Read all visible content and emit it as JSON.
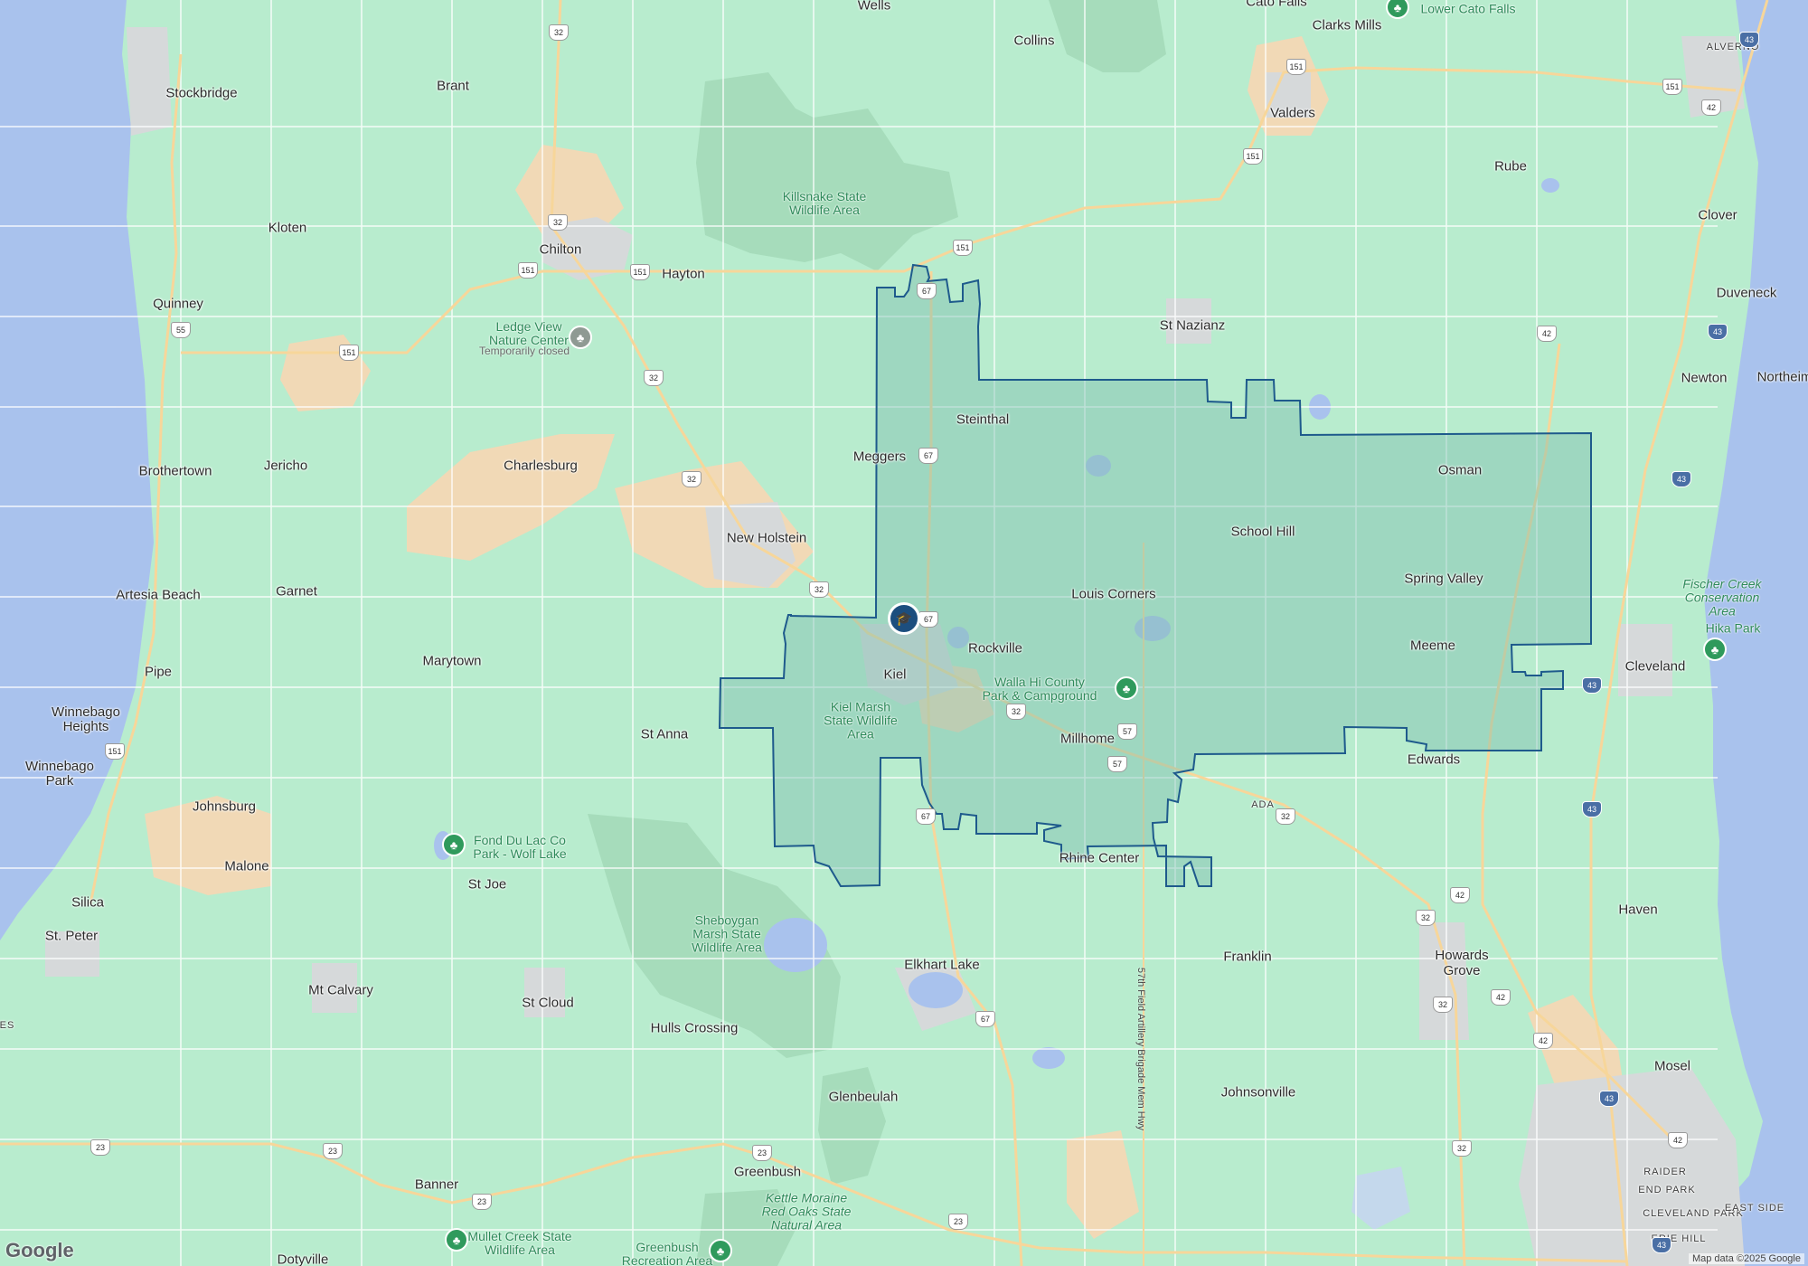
{
  "map": {
    "colors": {
      "land": "#b8ecce",
      "water": "#a9c2ed",
      "forest": "#a6dcbb",
      "urban": "#d6d9da",
      "farm": "#f1d9b6",
      "boundary_fill": "#7fbfb0",
      "boundary_stroke": "#1e5a8c",
      "road": "#ffffff",
      "highway": "#f7d69a"
    },
    "places": [
      {
        "id": "wells",
        "label": "Wells"
      },
      {
        "id": "cato-falls",
        "label": "Cato Falls"
      },
      {
        "id": "clarks-mills",
        "label": "Clarks Mills"
      },
      {
        "id": "collins",
        "label": "Collins"
      },
      {
        "id": "stockbridge",
        "label": "Stockbridge"
      },
      {
        "id": "brant",
        "label": "Brant"
      },
      {
        "id": "valders",
        "label": "Valders"
      },
      {
        "id": "rube",
        "label": "Rube"
      },
      {
        "id": "clover",
        "label": "Clover"
      },
      {
        "id": "kloten",
        "label": "Kloten"
      },
      {
        "id": "chilton",
        "label": "Chilton"
      },
      {
        "id": "hayton",
        "label": "Hayton"
      },
      {
        "id": "quinney",
        "label": "Quinney"
      },
      {
        "id": "st-nazianz",
        "label": "St Nazianz"
      },
      {
        "id": "duveneck",
        "label": "Duveneck"
      },
      {
        "id": "newton",
        "label": "Newton"
      },
      {
        "id": "northeim",
        "label": "Northeim"
      },
      {
        "id": "steinthal",
        "label": "Steinthal"
      },
      {
        "id": "meggers",
        "label": "Meggers"
      },
      {
        "id": "brothertown",
        "label": "Brothertown"
      },
      {
        "id": "jericho",
        "label": "Jericho"
      },
      {
        "id": "charlesburg",
        "label": "Charlesburg"
      },
      {
        "id": "osman",
        "label": "Osman"
      },
      {
        "id": "school-hill",
        "label": "School Hill"
      },
      {
        "id": "new-holstein",
        "label": "New Holstein"
      },
      {
        "id": "spring-valley",
        "label": "Spring Valley"
      },
      {
        "id": "artesia-beach",
        "label": "Artesia Beach"
      },
      {
        "id": "garnet",
        "label": "Garnet"
      },
      {
        "id": "louis-corners",
        "label": "Louis Corners"
      },
      {
        "id": "rockville",
        "label": "Rockville"
      },
      {
        "id": "meeme",
        "label": "Meeme"
      },
      {
        "id": "cleveland",
        "label": "Cleveland"
      },
      {
        "id": "marytown",
        "label": "Marytown"
      },
      {
        "id": "pipe",
        "label": "Pipe"
      },
      {
        "id": "kiel",
        "label": "Kiel"
      },
      {
        "id": "winnebago-heights",
        "label": "Winnebago\nHeights"
      },
      {
        "id": "st-anna",
        "label": "St Anna"
      },
      {
        "id": "millhome",
        "label": "Millhome"
      },
      {
        "id": "edwards",
        "label": "Edwards"
      },
      {
        "id": "winnebago-park",
        "label": "Winnebago\nPark"
      },
      {
        "id": "johnsburg",
        "label": "Johnsburg"
      },
      {
        "id": "malone",
        "label": "Malone"
      },
      {
        "id": "rhine-center",
        "label": "Rhine Center"
      },
      {
        "id": "st-joe",
        "label": "St Joe"
      },
      {
        "id": "silica",
        "label": "Silica"
      },
      {
        "id": "haven",
        "label": "Haven"
      },
      {
        "id": "st-peter",
        "label": "St. Peter"
      },
      {
        "id": "franklin",
        "label": "Franklin"
      },
      {
        "id": "howards-grove",
        "label": "Howards\nGrove"
      },
      {
        "id": "elkhart-lake",
        "label": "Elkhart Lake"
      },
      {
        "id": "mt-calvary",
        "label": "Mt Calvary"
      },
      {
        "id": "st-cloud",
        "label": "St Cloud"
      },
      {
        "id": "hulls-crossing",
        "label": "Hulls Crossing"
      },
      {
        "id": "mosel",
        "label": "Mosel"
      },
      {
        "id": "johnsonville",
        "label": "Johnsonville"
      },
      {
        "id": "glenbeulah",
        "label": "Glenbeulah"
      },
      {
        "id": "greenbush",
        "label": "Greenbush"
      },
      {
        "id": "banner",
        "label": "Banner"
      },
      {
        "id": "dotyville",
        "label": "Dotyville"
      }
    ],
    "small_labels": [
      {
        "id": "alverno",
        "label": "ALVERNO"
      },
      {
        "id": "ada",
        "label": "ADA"
      },
      {
        "id": "raider",
        "label": "RAIDER"
      },
      {
        "id": "end-park",
        "label": "END PARK"
      },
      {
        "id": "cleveland-park",
        "label": "CLEVELAND PARK"
      },
      {
        "id": "east-side",
        "label": "EAST SIDE"
      },
      {
        "id": "erie-hill",
        "label": "ERIE HILL"
      },
      {
        "id": "es",
        "label": "ES"
      }
    ],
    "parks": [
      {
        "id": "lower-cato-falls",
        "label": "Lower Cato Falls",
        "icon": "tree-icon"
      },
      {
        "id": "killsnake",
        "label": "Killsnake State\nWildlife Area",
        "icon": ""
      },
      {
        "id": "ledge-view",
        "label": "Ledge View\nNature Center",
        "icon": "tree-icon",
        "note": "Temporarily closed"
      },
      {
        "id": "fischer-creek",
        "label": "Fischer Creek\nConservation\nArea",
        "icon": ""
      },
      {
        "id": "hika-park",
        "label": "Hika Park",
        "icon": "tree-icon"
      },
      {
        "id": "walla-hi",
        "label": "Walla Hi County\nPark & Campground",
        "icon": "tree-icon"
      },
      {
        "id": "kiel-marsh",
        "label": "Kiel Marsh\nState Wildlife\nArea",
        "icon": ""
      },
      {
        "id": "fond-du-lac",
        "label": "Fond Du Lac Co\nPark - Wolf Lake",
        "icon": "tree-icon"
      },
      {
        "id": "sheboygan-marsh",
        "label": "Sheboygan\nMarsh State\nWildlife Area",
        "icon": ""
      },
      {
        "id": "kettle-moraine",
        "label": "Kettle Moraine\nRed Oaks State\nNatural Area",
        "icon": ""
      },
      {
        "id": "mullet-creek",
        "label": "Mullet Creek State\nWildlife Area",
        "icon": "tree-icon"
      },
      {
        "id": "greenbush-rec",
        "label": "Greenbush\nRecreation Area",
        "icon": "tree-icon"
      }
    ],
    "route_shields": [
      {
        "id": "r32a",
        "label": "32",
        "kind": "state"
      },
      {
        "id": "r151a",
        "label": "151",
        "kind": "us"
      },
      {
        "id": "r43a",
        "label": "43",
        "kind": "interstate"
      },
      {
        "id": "r42a",
        "label": "42",
        "kind": "state"
      },
      {
        "id": "r151b",
        "label": "151",
        "kind": "us"
      },
      {
        "id": "r151c",
        "label": "151",
        "kind": "us"
      },
      {
        "id": "r32b",
        "label": "32",
        "kind": "state"
      },
      {
        "id": "r151d",
        "label": "151",
        "kind": "us"
      },
      {
        "id": "r151e",
        "label": "151",
        "kind": "us"
      },
      {
        "id": "r151f",
        "label": "151",
        "kind": "us"
      },
      {
        "id": "r67a",
        "label": "67",
        "kind": "state"
      },
      {
        "id": "r55",
        "label": "55",
        "kind": "state"
      },
      {
        "id": "r151g",
        "label": "151",
        "kind": "us"
      },
      {
        "id": "r42b",
        "label": "42",
        "kind": "state"
      },
      {
        "id": "r43b",
        "label": "43",
        "kind": "interstate"
      },
      {
        "id": "r32c",
        "label": "32",
        "kind": "state"
      },
      {
        "id": "r67b",
        "label": "67",
        "kind": "state"
      },
      {
        "id": "r32d",
        "label": "32",
        "kind": "state"
      },
      {
        "id": "r43c",
        "label": "43",
        "kind": "interstate"
      },
      {
        "id": "r67c",
        "label": "67",
        "kind": "state"
      },
      {
        "id": "r32e",
        "label": "32",
        "kind": "state"
      },
      {
        "id": "r43d",
        "label": "43",
        "kind": "interstate"
      },
      {
        "id": "r57a",
        "label": "57",
        "kind": "state"
      },
      {
        "id": "r32f",
        "label": "32",
        "kind": "state"
      },
      {
        "id": "r57b",
        "label": "57",
        "kind": "state"
      },
      {
        "id": "r151h",
        "label": "151",
        "kind": "us"
      },
      {
        "id": "r67d",
        "label": "67",
        "kind": "state"
      },
      {
        "id": "r32g",
        "label": "32",
        "kind": "state"
      },
      {
        "id": "r43e",
        "label": "43",
        "kind": "interstate"
      },
      {
        "id": "r42c",
        "label": "42",
        "kind": "state"
      },
      {
        "id": "r32h",
        "label": "32",
        "kind": "state"
      },
      {
        "id": "r42d",
        "label": "42",
        "kind": "state"
      },
      {
        "id": "r32i",
        "label": "32",
        "kind": "state"
      },
      {
        "id": "r42e",
        "label": "42",
        "kind": "state"
      },
      {
        "id": "r67e",
        "label": "67",
        "kind": "state"
      },
      {
        "id": "r43f",
        "label": "43",
        "kind": "interstate"
      },
      {
        "id": "r23a",
        "label": "23",
        "kind": "state"
      },
      {
        "id": "r23b",
        "label": "23",
        "kind": "state"
      },
      {
        "id": "r23c",
        "label": "23",
        "kind": "state"
      },
      {
        "id": "r32j",
        "label": "32",
        "kind": "state"
      },
      {
        "id": "r42f",
        "label": "42",
        "kind": "state"
      },
      {
        "id": "r23d",
        "label": "23",
        "kind": "state"
      },
      {
        "id": "r23e",
        "label": "23",
        "kind": "state"
      },
      {
        "id": "r43g",
        "label": "43",
        "kind": "interstate"
      }
    ],
    "road_label": "57th Field Artillery Brigade Mem Hwy",
    "school_marker_icon": "graduation-cap-icon",
    "logo": "Google",
    "attribution": "Map data ©2025 Google"
  }
}
